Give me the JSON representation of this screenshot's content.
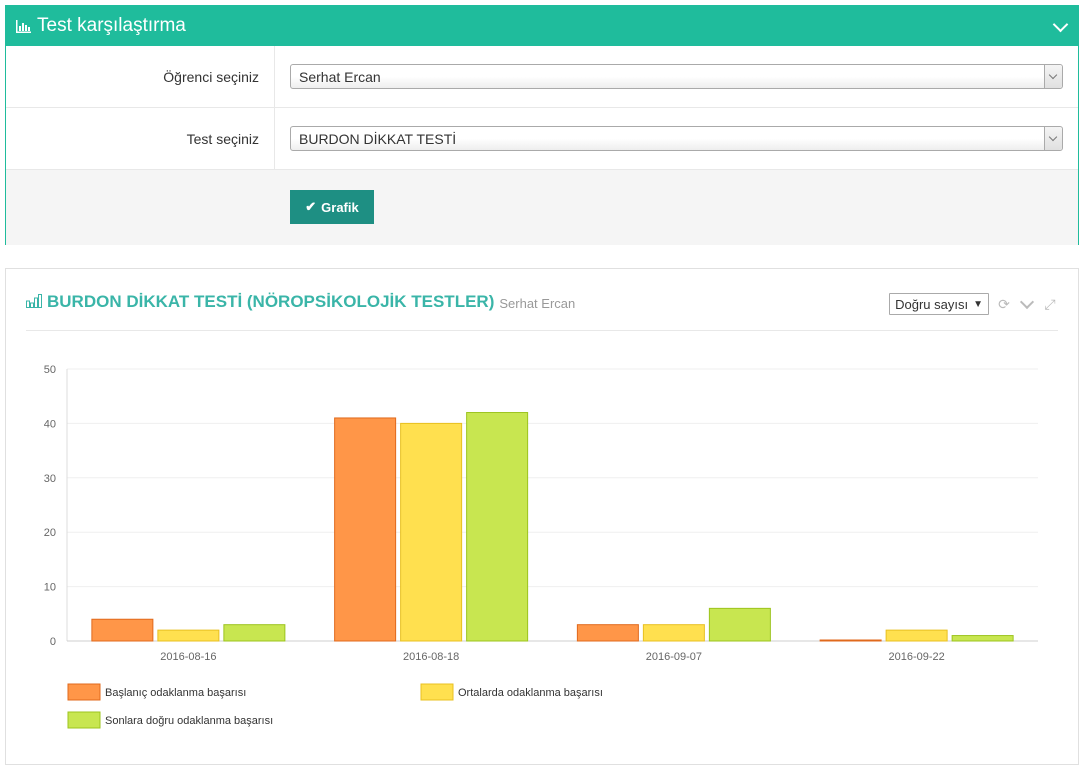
{
  "top_panel": {
    "title": "Test karşılaştırma",
    "student_label": "Öğrenci seçiniz",
    "student_value": "Serhat Ercan",
    "test_label": "Test seçiniz",
    "test_value": "BURDON DİKKAT TESTİ",
    "button_label": "Grafik",
    "header_color": "#1fbc9c",
    "button_color": "#1e8f83"
  },
  "chart_panel": {
    "title": "BURDON DİKKAT TESTİ (NÖROPSİKOLOJİK TESTLER)",
    "subtitle": "Serhat Ercan",
    "metric_value": "Doğru sayısı"
  },
  "icons": {
    "header_icon": "bar-chart-icon",
    "refresh": "refresh-icon",
    "collapse": "chevron-down-icon",
    "expand": "expand-icon"
  },
  "chart_data": {
    "type": "bar",
    "categories": [
      "2016-08-16",
      "2016-08-18",
      "2016-09-07",
      "2016-09-22"
    ],
    "series": [
      {
        "name": "Başlanıç odaklanma başarısı",
        "values": [
          4,
          41,
          3,
          0
        ],
        "color": "#ff9648",
        "border": "#e0691c"
      },
      {
        "name": "Ortalarda odaklanma başarısı",
        "values": [
          2,
          40,
          3,
          2
        ],
        "color": "#ffe04f",
        "border": "#e8c020"
      },
      {
        "name": "Sonlara doğru odaklanma başarısı",
        "values": [
          3,
          42,
          6,
          1
        ],
        "color": "#c8e650",
        "border": "#9cc41e"
      }
    ],
    "yticks": [
      0,
      10,
      20,
      30,
      40,
      50
    ],
    "ylim": [
      0,
      50
    ],
    "grid": true,
    "legend": "bottom"
  }
}
